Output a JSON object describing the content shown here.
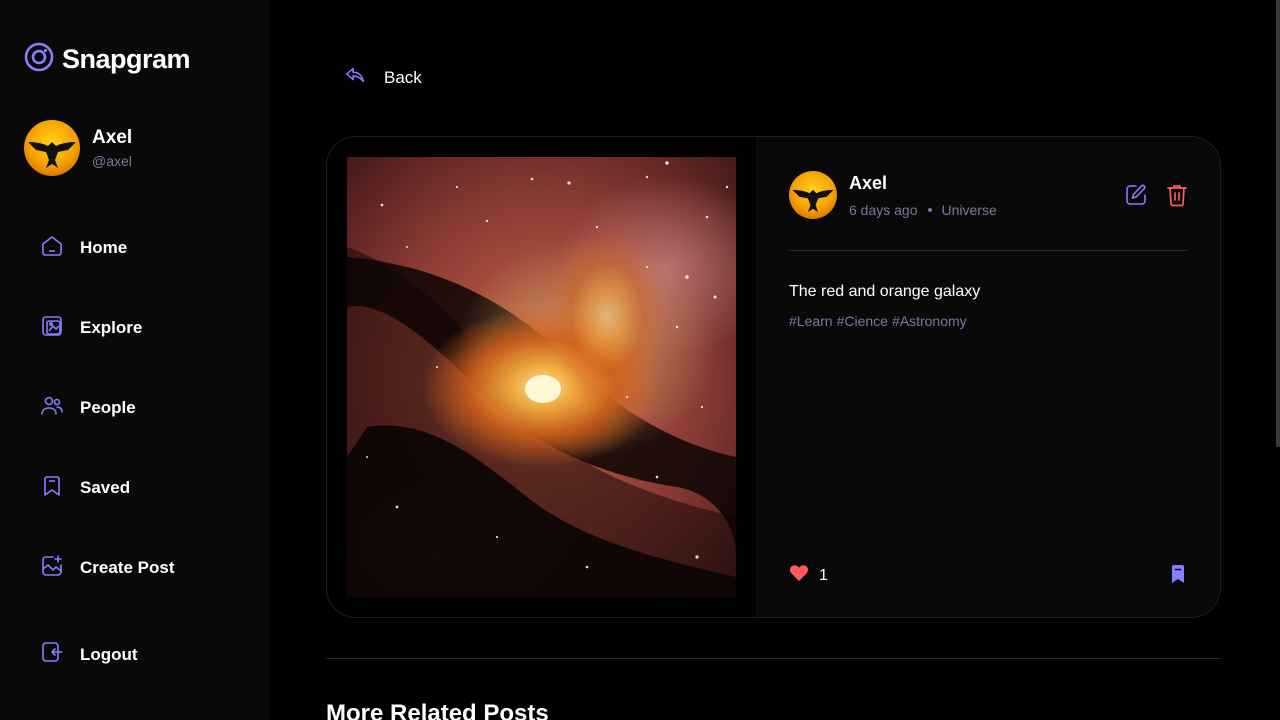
{
  "app": {
    "name": "Snapgram"
  },
  "user": {
    "name": "Axel",
    "handle": "@axel"
  },
  "nav": [
    {
      "label": "Home",
      "icon": "home-icon"
    },
    {
      "label": "Explore",
      "icon": "explore-icon"
    },
    {
      "label": "People",
      "icon": "people-icon"
    },
    {
      "label": "Saved",
      "icon": "saved-icon"
    },
    {
      "label": "Create Post",
      "icon": "create-post-icon"
    }
  ],
  "logout": {
    "label": "Logout"
  },
  "back": {
    "label": "Back"
  },
  "post": {
    "author": "Axel",
    "time": "6 days ago",
    "location": "Universe",
    "caption": "The red and orange galaxy",
    "tags": [
      "#Learn",
      "#Cience",
      "#Astronomy"
    ],
    "likes": "1",
    "liked": true,
    "saved": true
  },
  "related": {
    "title": "More Related Posts"
  },
  "colors": {
    "accent": "#877eff",
    "like": "#ff5a5a",
    "muted": "#7878a3",
    "sidebar": "#09090a",
    "background": "#000000"
  }
}
